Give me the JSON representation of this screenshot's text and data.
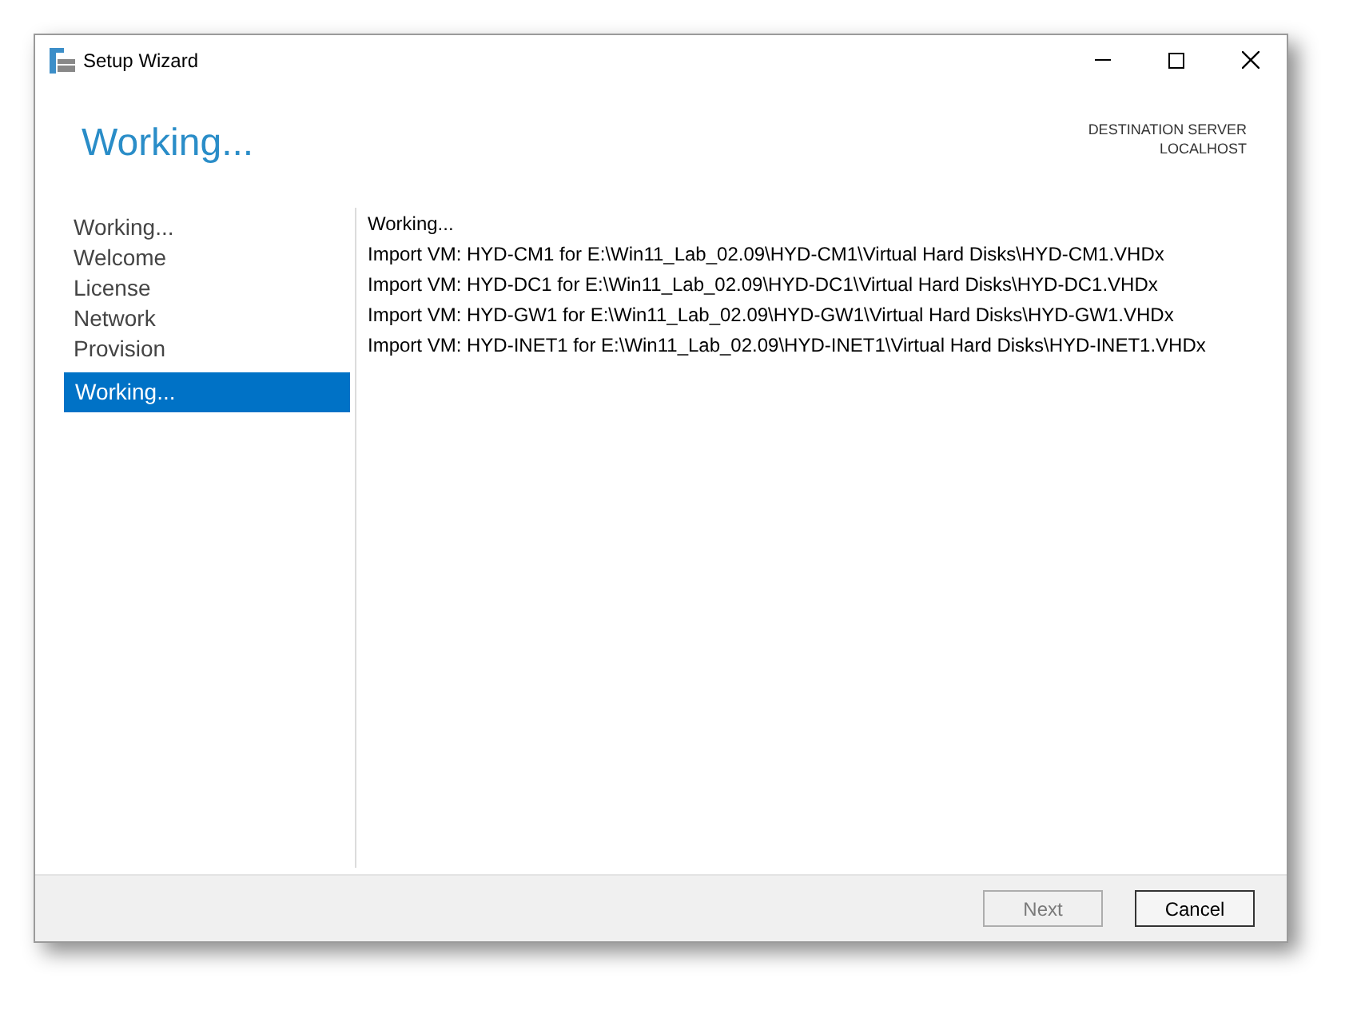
{
  "window": {
    "title": "Setup Wizard"
  },
  "page_title": "Working...",
  "destination": {
    "label": "DESTINATION SERVER",
    "server": "LOCALHOST"
  },
  "steps": [
    {
      "label": "Working...",
      "selected": false
    },
    {
      "label": "Welcome",
      "selected": false
    },
    {
      "label": "License",
      "selected": false
    },
    {
      "label": "Network",
      "selected": false
    },
    {
      "label": "Provision",
      "selected": false
    },
    {
      "label": "Working...",
      "selected": true
    }
  ],
  "log": [
    "Working...",
    "Import VM: HYD-CM1 for E:\\Win11_Lab_02.09\\HYD-CM1\\Virtual Hard Disks\\HYD-CM1.VHDx",
    "Import VM: HYD-DC1 for E:\\Win11_Lab_02.09\\HYD-DC1\\Virtual Hard Disks\\HYD-DC1.VHDx",
    "Import VM: HYD-GW1 for E:\\Win11_Lab_02.09\\HYD-GW1\\Virtual Hard Disks\\HYD-GW1.VHDx",
    "Import VM: HYD-INET1 for E:\\Win11_Lab_02.09\\HYD-INET1\\Virtual Hard Disks\\HYD-INET1.VHDx"
  ],
  "buttons": [
    {
      "label": "Next",
      "disabled": true
    },
    {
      "label": "Cancel",
      "disabled": false
    }
  ]
}
